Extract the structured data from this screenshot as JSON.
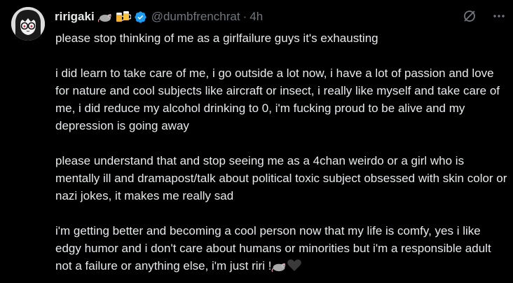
{
  "tweet": {
    "author": {
      "display_name": "ririgaki",
      "handle": "@dumbfrenchrat",
      "emojis": [
        "rat-emoji",
        "beer-mugs-emoji"
      ],
      "verified": true
    },
    "timestamp": "4h",
    "separator": "·",
    "paragraphs": [
      "please stop thinking of me as a girlfailure guys it's exhausting",
      "i did learn to take care of me, i go outside a lot now, i have a lot of passion and love for nature and cool subjects like aircraft or insect, i really like myself and take care of me, i did reduce my alcohol drinking to 0, i'm fucking proud to be alive and my depression is going away",
      "please understand that and stop seeing me as a 4chan weirdo or a girl who is mentally ill and dramapost/talk about political toxic subject obsessed with skin color or nazi jokes, it makes me really sad",
      "i'm getting better and becoming a cool person now that my life is comfy, yes i like edgy humor and i don't care about humans or minorities but i'm a responsible adult not a failure or anything else, i'm just riri !"
    ],
    "trailing_emojis": [
      "rat-emoji",
      "black-heart-emoji"
    ]
  },
  "colors": {
    "background": "#000000",
    "text": "#e7e9ea",
    "muted": "#71767b",
    "verified": "#1d9bf0"
  }
}
